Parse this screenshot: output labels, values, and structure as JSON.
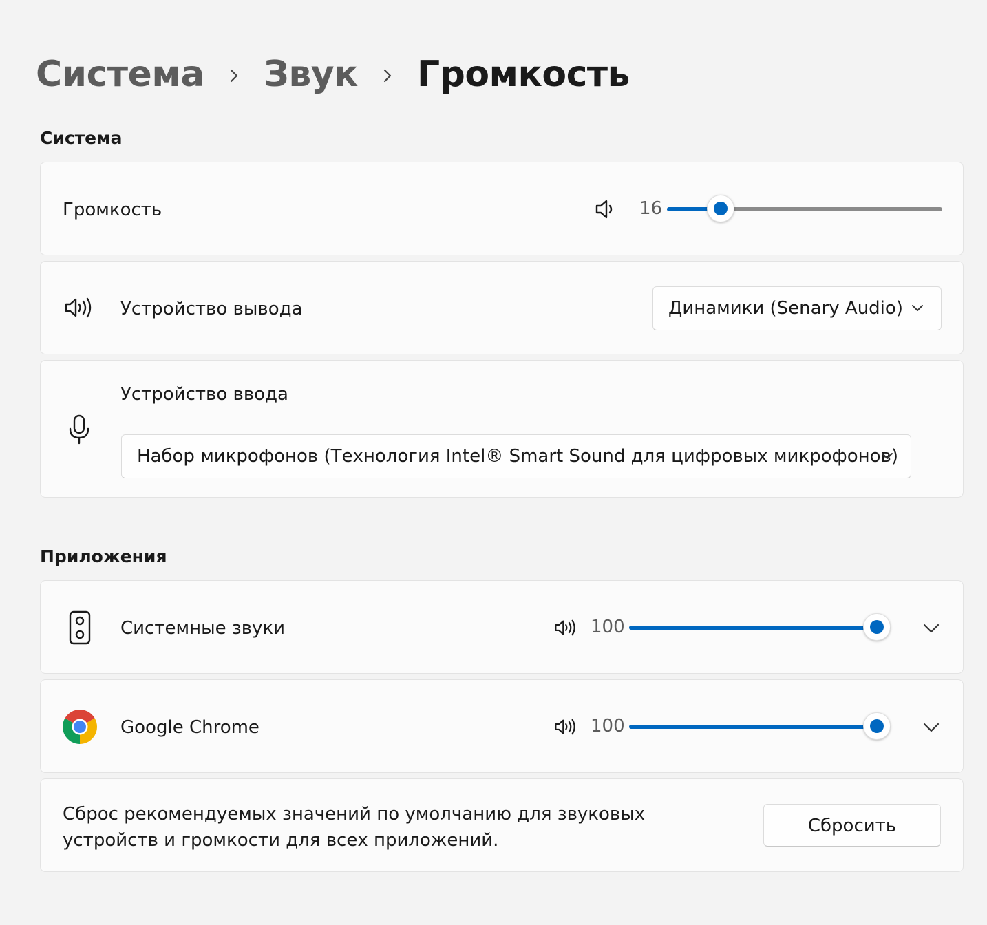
{
  "breadcrumb": {
    "items": [
      "Система",
      "Звук",
      "Громкость"
    ],
    "separator_icon": "chevron-right-icon"
  },
  "system_section": {
    "title": "Система",
    "volume": {
      "label": "Громкость",
      "icon": "speaker-low-icon",
      "value": "16",
      "level_percent": 16
    },
    "output": {
      "label": "Устройство вывода",
      "icon": "speaker-high-icon",
      "selected": "Динамики (Senary Audio)"
    },
    "input": {
      "label": "Устройство ввода",
      "icon": "microphone-icon",
      "selected": "Набор микрофонов (Технология Intel® Smart Sound для цифровых микрофонов)"
    }
  },
  "apps_section": {
    "title": "Приложения",
    "apps": [
      {
        "name": "Системные звуки",
        "icon": "system-sounds-speaker-icon",
        "value": "100",
        "level_percent": 100
      },
      {
        "name": "Google Chrome",
        "icon": "chrome-logo-icon",
        "value": "100",
        "level_percent": 100
      }
    ],
    "reset": {
      "text": "Сброс рекомендуемых значений по умолчанию для звуковых устройств и громкости для всех приложений.",
      "button_label": "Сбросить"
    }
  },
  "colors": {
    "accent": "#0067c0",
    "background": "#f3f3f3",
    "card": "#fbfbfb"
  }
}
